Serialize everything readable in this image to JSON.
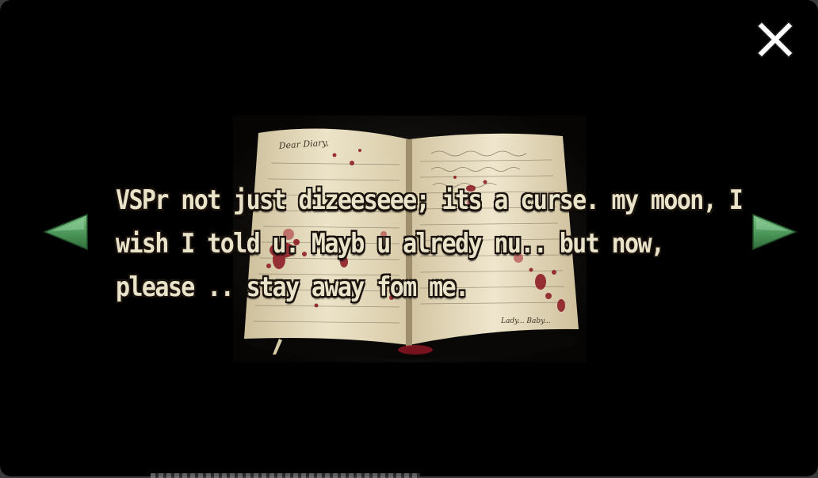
{
  "note": {
    "lines": [
      "VSPr not just dizeeseee; its a curse. my moon, I",
      "wish I told u. Mayb u alredy nu.. but now,",
      "please .. stay away fom me."
    ]
  },
  "diary_image": {
    "left_page_heading": "Dear Diary,",
    "right_page_signature": "Lady... Baby..."
  },
  "controls": {
    "close_icon": "close-icon",
    "prev_icon": "arrow-left-icon",
    "next_icon": "arrow-right-icon"
  },
  "colors": {
    "background": "#000000",
    "text": "#e9e3c9",
    "text_outline": "#1a120c",
    "arrow": "#4f9a5c",
    "close": "#ffffff",
    "paper": "#e6dcc0",
    "blood": "#8a1420"
  }
}
